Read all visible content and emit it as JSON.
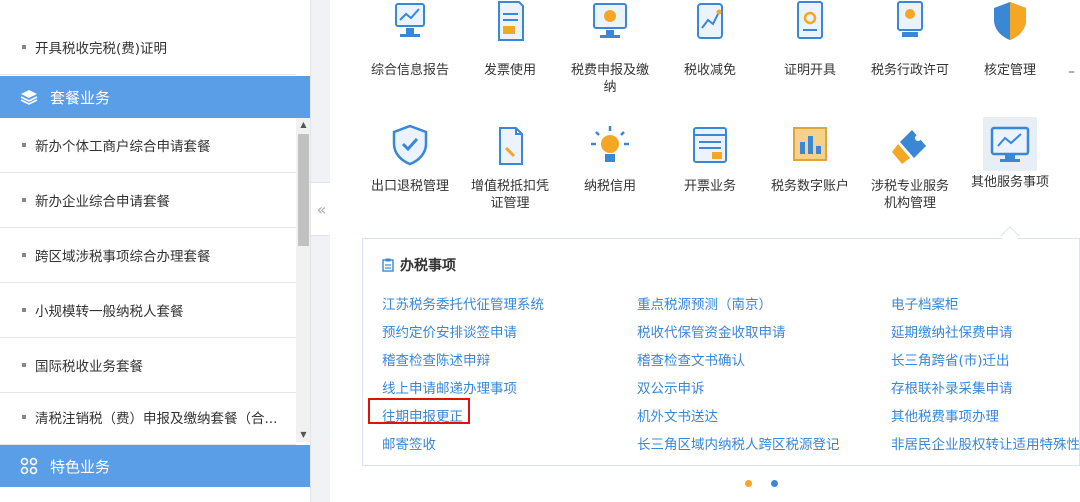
{
  "sidebar": {
    "top_item": "开具税收完税(费)证明",
    "section_package": "套餐业务",
    "items": [
      "新办个体工商户综合申请套餐",
      "新办企业综合申请套餐",
      "跨区域涉税事项综合办理套餐",
      "小规模转一般纳税人套餐",
      "国际税收业务套餐",
      "清税注销税（费）申报及缴纳套餐（合..."
    ],
    "section_special": "特色业务"
  },
  "icons_row1": [
    {
      "label": "综合信息报告",
      "icon": "report-icon"
    },
    {
      "label": "发票使用",
      "icon": "invoice-icon"
    },
    {
      "label": "税费申报及缴纳",
      "icon": "tax-declare-icon"
    },
    {
      "label": "税收减免",
      "icon": "tax-relief-icon"
    },
    {
      "label": "证明开具",
      "icon": "certificate-icon"
    },
    {
      "label": "税务行政许可",
      "icon": "license-icon"
    },
    {
      "label": "核定管理",
      "icon": "shield-icon"
    }
  ],
  "icons_row2": [
    {
      "label": "出口退税管理",
      "icon": "export-refund-icon"
    },
    {
      "label": "增值税抵扣凭证管理",
      "icon": "vat-deduction-icon"
    },
    {
      "label": "纳税信用",
      "icon": "credit-icon"
    },
    {
      "label": "开票业务",
      "icon": "invoicing-icon"
    },
    {
      "label": "税务数字账户",
      "icon": "digital-account-icon"
    },
    {
      "label": "涉税专业服务机构管理",
      "icon": "agency-icon"
    },
    {
      "label": "其他服务事项",
      "icon": "other-services-icon"
    }
  ],
  "panel": {
    "title": "办税事项",
    "col1": [
      "江苏税务委托代征管理系统",
      "预约定价安排谈签申请",
      "稽查检查陈述申辩",
      "线上申请邮递办理事项",
      "往期申报更正",
      "邮寄签收"
    ],
    "col2": [
      "重点税源预测（南京）",
      "税收代保管资金收取申请",
      "稽查检查文书确认",
      "双公示申诉",
      "机外文书送达",
      "长三角区域内纳税人跨区税源登记"
    ],
    "col3": [
      "电子档案柜",
      "延期缴纳社保费申请",
      "长三角跨省(市)迁出",
      "存根联补录采集申请",
      "其他税费事项办理",
      "非居民企业股权转让适用特殊性税务处理"
    ]
  },
  "colors": {
    "accent": "#5a9ee8",
    "link": "#3a87d6",
    "highlight": "#e01010"
  }
}
